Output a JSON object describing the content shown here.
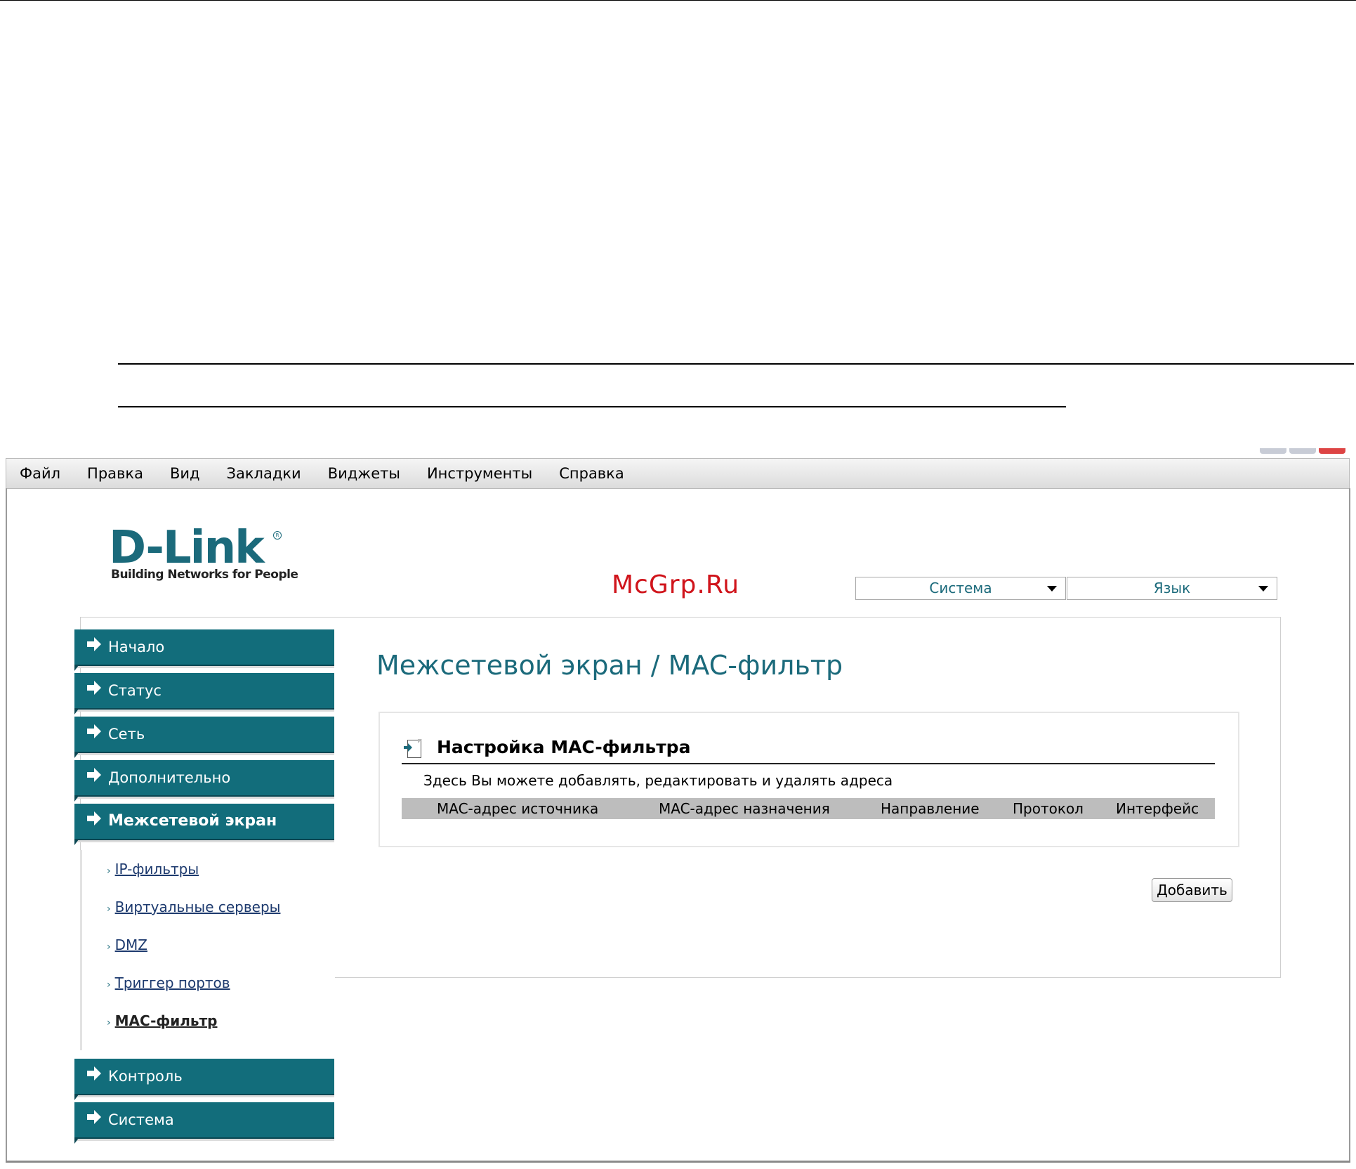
{
  "menubar": [
    "Файл",
    "Правка",
    "Вид",
    "Закладки",
    "Виджеты",
    "Инструменты",
    "Справка"
  ],
  "logo": {
    "name": "D-Link",
    "tagline": "Building Networks for People"
  },
  "watermark": "McGrp.Ru",
  "header_selects": {
    "system": "Система",
    "language": "Язык"
  },
  "sidebar": {
    "items": [
      "Начало",
      "Статус",
      "Сеть",
      "Дополнительно",
      "Межсетевой экран",
      "Контроль",
      "Система"
    ],
    "active": "Межсетевой экран",
    "subitems": [
      "IP-фильтры",
      "Виртуальные серверы",
      "DMZ",
      "Триггер портов",
      "MAC-фильтр"
    ],
    "current_subitem": "MAC-фильтр"
  },
  "main": {
    "title": "Межсетевой экран /  MAC-фильтр",
    "section_title": "Настройка MAC-фильтра",
    "description": "Здесь Вы можете добавлять, редактировать и удалять адреса",
    "table_headers": [
      "MAC-адрес источника",
      "MAC-адрес назначения",
      "Направление",
      "Протокол",
      "Интерфейс"
    ],
    "add_button": "Добавить"
  },
  "colors": {
    "brand_teal": "#126d7b",
    "watermark_red": "#d0141b",
    "header_gray": "#bdbdbd"
  }
}
